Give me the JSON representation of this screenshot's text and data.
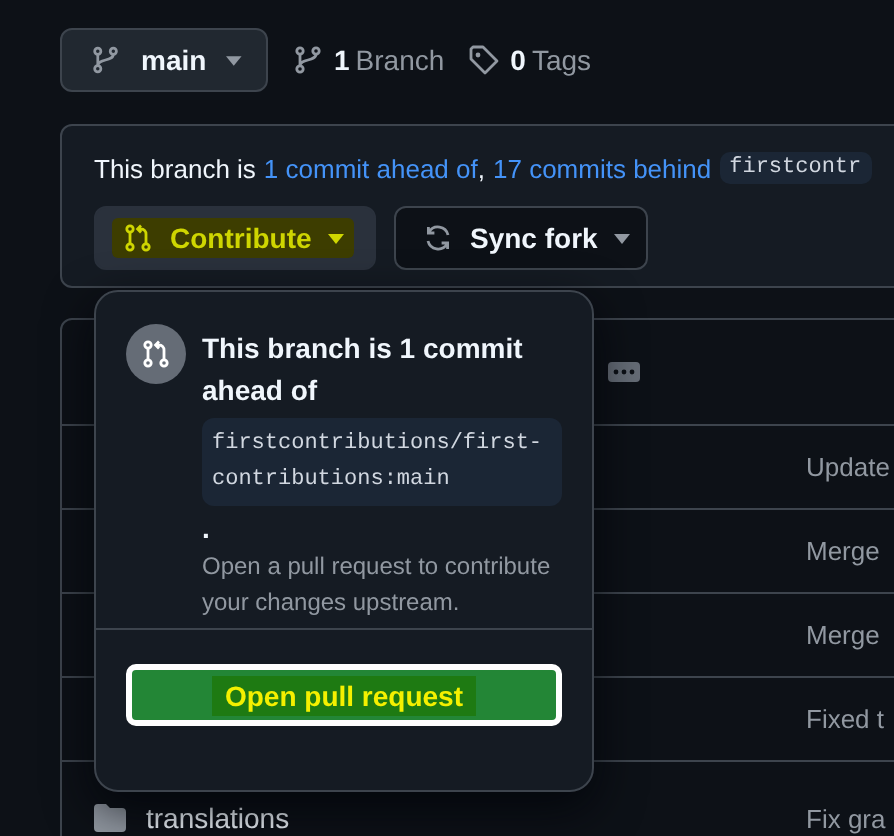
{
  "branch_selector": {
    "label": "main"
  },
  "branch_count": {
    "count": "1",
    "label": "Branch"
  },
  "tag_count": {
    "count": "0",
    "label": "Tags"
  },
  "status_banner": {
    "prefix": "This branch is",
    "ahead_link": "1 commit ahead of",
    "separator": ",",
    "behind_link": "17 commits behind",
    "upstream": "firstcontr"
  },
  "actions": [
    {
      "label": "Contribute",
      "kind": "contribute",
      "highlighted": true,
      "expanded": true
    },
    {
      "label": "Sync fork",
      "kind": "sync",
      "highlighted": false
    }
  ],
  "file_table": {
    "rows": [
      {
        "message": "Update"
      },
      {
        "message": "Merge"
      },
      {
        "message": "Merge"
      },
      {
        "message": "Fixed t"
      },
      {
        "name": "translations",
        "kind": "folder",
        "message": "Fix gra"
      }
    ]
  },
  "popover": {
    "title": "This branch is 1 commit ahead of",
    "ref": "firstcontributions/first-contributions:main",
    "period": ".",
    "description": "Open a pull request to contribute your changes upstream.",
    "button": {
      "label": "Open pull request",
      "highlighted": true
    }
  }
}
